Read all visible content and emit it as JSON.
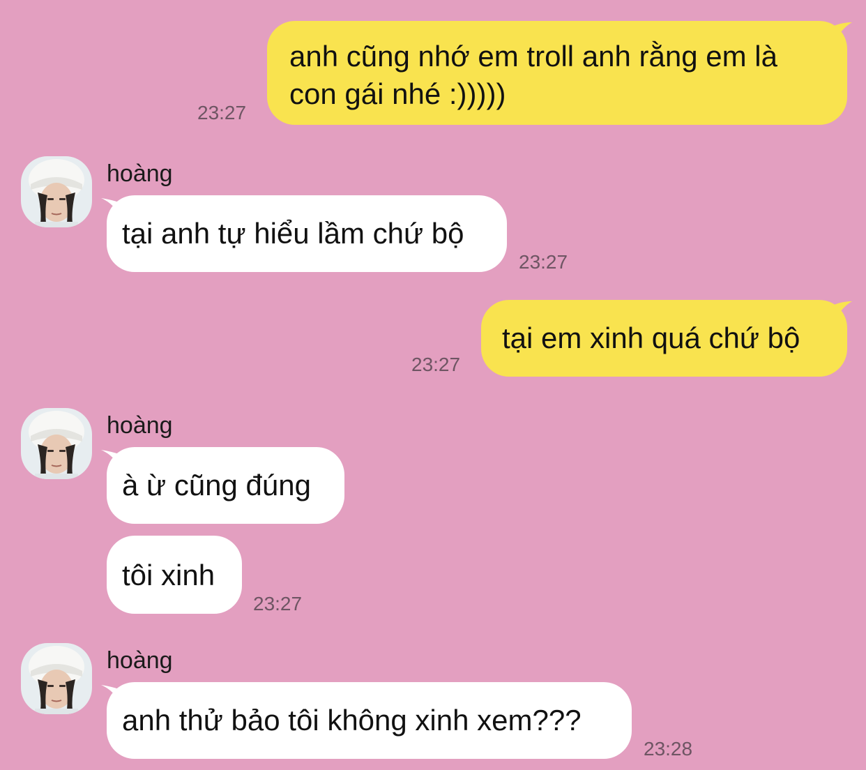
{
  "colors": {
    "background": "#e39fc0",
    "outgoing_bubble": "#f9e34f",
    "incoming_bubble": "#ffffff",
    "timestamp": "#6e5563"
  },
  "messages": [
    {
      "direction": "outgoing",
      "lines": [
        "anh cũng nhớ em troll anh rằng em là",
        "con gái nhé :)))))"
      ],
      "time": "23:27"
    },
    {
      "direction": "incoming",
      "sender": "hoàng",
      "avatar_icon": "profile-photo-icon",
      "text": "tại anh tự hiểu lầm chứ bộ",
      "time": "23:27"
    },
    {
      "direction": "outgoing",
      "text": "tại em xinh quá chứ bộ",
      "time": "23:27"
    },
    {
      "direction": "incoming",
      "sender": "hoàng",
      "avatar_icon": "profile-photo-icon",
      "text": "à ừ cũng đúng"
    },
    {
      "direction": "incoming",
      "text": "tôi xinh",
      "time": "23:27"
    },
    {
      "direction": "incoming",
      "sender": "hoàng",
      "avatar_icon": "profile-photo-icon",
      "text": "anh thử bảo tôi không xinh xem???",
      "time": "23:28"
    }
  ]
}
